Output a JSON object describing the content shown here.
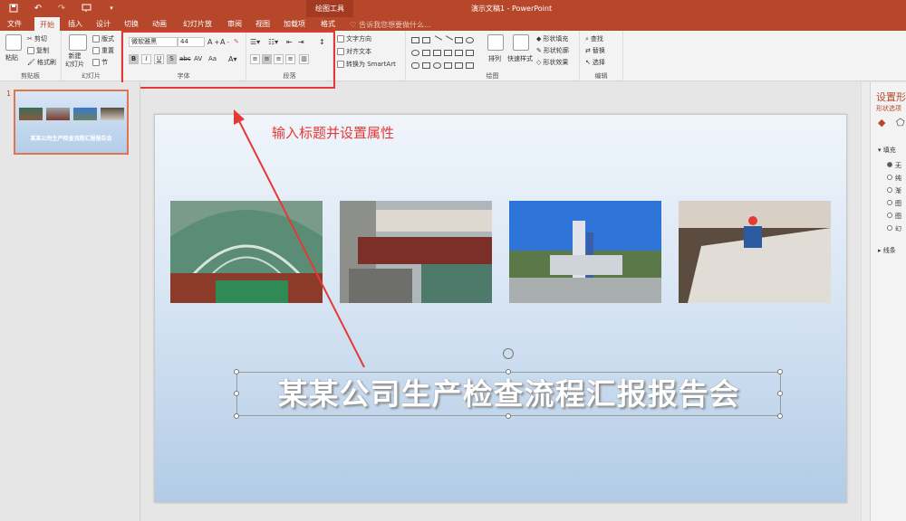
{
  "app": {
    "document_title": "演示文稿1 - PowerPoint",
    "context_group": "绘图工具"
  },
  "tabs": [
    "文件",
    "开始",
    "插入",
    "设计",
    "切换",
    "动画",
    "幻灯片放映",
    "审阅",
    "视图",
    "加载项",
    "格式"
  ],
  "active_tab": "开始",
  "tell_me": "告诉我您想要做什么...",
  "ribbon": {
    "clipboard": {
      "label": "剪贴板",
      "paste": "粘贴",
      "cut": "剪切",
      "copy": "复制",
      "format_painter": "格式刷"
    },
    "slides": {
      "label": "幻灯片",
      "new_slide": "新建\n幻灯片",
      "layout": "版式",
      "reset": "重置",
      "section": "节"
    },
    "font": {
      "label": "字体",
      "font_name": "微软雅黑",
      "font_size": "44",
      "bold": "B",
      "italic": "I",
      "underline": "U",
      "shadow": "S",
      "strike": "abc",
      "spacing": "AV",
      "case": "Aa"
    },
    "paragraph": {
      "label": "段落"
    },
    "text_direction": "文字方向",
    "align_text": "对齐文本",
    "smartart": "转换为 SmartArt",
    "drawing": {
      "label": "绘图",
      "arrange": "排列",
      "quick_styles": "快速样式",
      "shape_fill": "形状填充",
      "shape_outline": "形状轮廓",
      "shape_effects": "形状效果"
    },
    "editing": {
      "label": "编辑",
      "find": "查找",
      "replace": "替换",
      "select": "选择"
    }
  },
  "thumbnails": [
    {
      "number": "1",
      "title": "某某公司生产检查流程汇报报告会"
    }
  ],
  "slide": {
    "title": "某某公司生产检查流程汇报报告会"
  },
  "annotation": "输入标题并设置属性",
  "format_pane": {
    "title": "设置形",
    "tab": "形状选项",
    "fill": "填充",
    "line": "线条",
    "options": [
      "无",
      "纯",
      "渐",
      "图",
      "图",
      "幻"
    ]
  },
  "colors": {
    "accent": "#b7472a",
    "annotation": "#e53935"
  }
}
